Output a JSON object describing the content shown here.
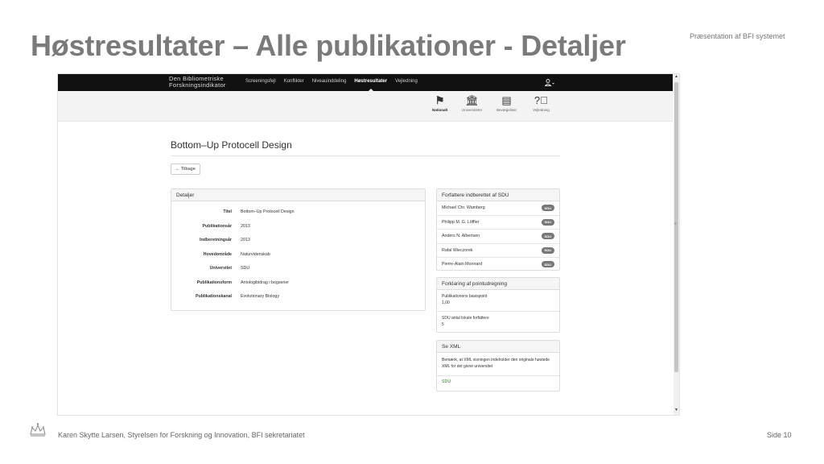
{
  "slide": {
    "title": "Høstresultater – Alle publikationer - Detaljer",
    "subtitle": "Præsentation af BFI systemet",
    "footer": "Karen Skytte Larsen, Styrelsen for Forskning og Innovation, BFI sekretariatet",
    "page": "Side 10"
  },
  "app": {
    "brand_line1": "Den Bibliometriske",
    "brand_line2": "Forskningsindikator",
    "nav": [
      "Screeningsfejl",
      "Konflikter",
      "Niveauinddeling",
      "Høstresultater",
      "Vejledning"
    ],
    "nav_active": "Høstresultater",
    "user_icon": "user-icon",
    "subnav": [
      {
        "label": "Nationalt",
        "icon": "flag-icon"
      },
      {
        "label": "Universiteter",
        "icon": "institution-icon"
      },
      {
        "label": "Bevægeliser",
        "icon": "calendar-icon"
      },
      {
        "label": "Vejledning",
        "icon": "help-icon"
      }
    ]
  },
  "page": {
    "title": "Bottom–Up Protocell Design",
    "back_label": "← Tilbage"
  },
  "details": {
    "heading": "Detaljer",
    "rows": [
      {
        "label": "Titel",
        "value": "Bottom–Up Protocell Design"
      },
      {
        "label": "Publikationsår",
        "value": "2013"
      },
      {
        "label": "Indberetningsår",
        "value": "2013"
      },
      {
        "label": "Hovedområde",
        "value": "Naturvidenskab"
      },
      {
        "label": "Universitet",
        "value": "SDU"
      },
      {
        "label": "Publikationsform",
        "value": "Antologibidrag i bogserier"
      },
      {
        "label": "Publikationskanal",
        "value": "Evolutionary Biology"
      }
    ]
  },
  "authors": {
    "heading": "Forfattere indberettet af SDU",
    "items": [
      {
        "name": "Michael Chr. Wamberg",
        "badge": "SDU"
      },
      {
        "name": "Philipp M. G. Löffler",
        "badge": "SDU"
      },
      {
        "name": "Anders N. Albertsen",
        "badge": "SDU"
      },
      {
        "name": "Rafal Wieczorek",
        "badge": "SDU"
      },
      {
        "name": "Pierre-Alain Monnard",
        "badge": "SDU"
      }
    ]
  },
  "points": {
    "heading": "Forklaring af pointudregning",
    "base_label": "Publikationens basispoint",
    "base_value": "1,00",
    "local_label": "SDU antal lokale forfattere",
    "local_value": "5"
  },
  "xml": {
    "heading": "Se XML",
    "note": "Bemærk, at XML visningen indeholder den originale høstede XML for det givne universitet",
    "link": "SDU"
  }
}
